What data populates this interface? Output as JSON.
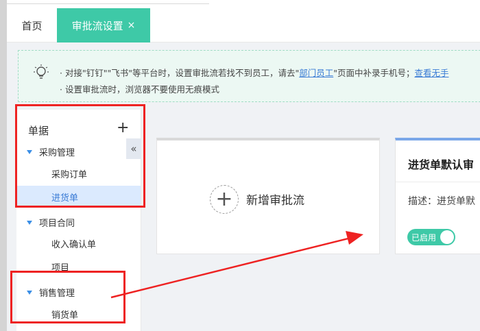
{
  "tabs": {
    "home": "首页",
    "active": "审批流设置",
    "close": "×"
  },
  "notice": {
    "line1_prefix": "· 对接\"钉钉\"\"飞书\"等平台时，设置审批流若找不到员工，请去\"",
    "line1_link": "部门员工",
    "line1_middle": "\"页面中补录手机号；",
    "line1_link2": "查看无手",
    "line2": "· 设置审批流时，浏览器不要使用无痕模式"
  },
  "sidebar": {
    "title": "单据",
    "add": "+",
    "collapse": "«",
    "groups": [
      {
        "label": "采购管理",
        "items": [
          "采购订单",
          "进货单"
        ]
      },
      {
        "label": "项目合同",
        "items": [
          "收入确认单",
          "项目"
        ]
      },
      {
        "label": "销售管理",
        "items": [
          "销货单"
        ]
      }
    ],
    "active_item": "进货单"
  },
  "cards": {
    "add_icon": "+",
    "add_label": "新增审批流",
    "flow_title": "进货单默认审",
    "flow_desc": "描述：进货单默",
    "toggle_label": "已启用",
    "toggle_enabled": true
  },
  "colors": {
    "accent": "#3ec9a7",
    "link": "#3a7bd5",
    "annotation": "#ee2222"
  }
}
